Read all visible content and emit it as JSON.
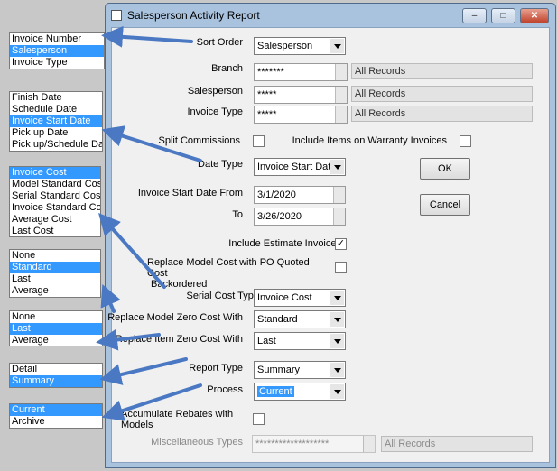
{
  "lists": [
    {
      "items": [
        "Invoice Number",
        "Salesperson",
        "Invoice Type"
      ],
      "selected": 1
    },
    {
      "items": [
        "Finish Date",
        "Schedule Date",
        "Invoice Start Date",
        "Pick up Date",
        "Pick up/Schedule Date"
      ],
      "selected": 2
    },
    {
      "items": [
        "Invoice Cost",
        "Model Standard Cost",
        "Serial Standard Cost",
        "Invoice Standard Cost",
        "Average Cost",
        "Last Cost"
      ],
      "selected": 0
    },
    {
      "items": [
        "None",
        "Standard",
        "Last",
        "Average"
      ],
      "selected": 1
    },
    {
      "items": [
        "None",
        "Last",
        "Average"
      ],
      "selected": 1
    },
    {
      "items": [
        "Detail",
        "Summary"
      ],
      "selected": 1
    },
    {
      "items": [
        "Current",
        "Archive"
      ],
      "selected": 0
    }
  ],
  "window": {
    "title": "Salesperson Activity Report",
    "minimize": "‒",
    "maximize": "□",
    "close": "✕"
  },
  "form": {
    "sort_order": {
      "label": "Sort Order",
      "value": "Salesperson"
    },
    "branch": {
      "label": "Branch",
      "value": "*******",
      "scope": "All Records"
    },
    "salesperson": {
      "label": "Salesperson",
      "value": "*****",
      "scope": "All Records"
    },
    "invoice_type": {
      "label": "Invoice Type",
      "value": "*****",
      "scope": "All Records"
    },
    "split_commissions": {
      "label": "Split Commissions",
      "checked": false
    },
    "include_warranty": {
      "label": "Include Items on Warranty Invoices",
      "checked": false
    },
    "date_type": {
      "label": "Date Type",
      "value": "Invoice Start Dat"
    },
    "start_from": {
      "label": "Invoice Start Date From",
      "value": "3/1/2020"
    },
    "to": {
      "label": "To",
      "value": "3/26/2020"
    },
    "include_estimate": {
      "label": "Include Estimate Invoices",
      "checked": true,
      "mark": "✓"
    },
    "replace_model_cost": {
      "label_line1": "Replace Model Cost with PO Quoted Cost",
      "label_line2": "Backordered",
      "checked": false
    },
    "serial_cost_type": {
      "label": "Serial Cost Type",
      "value": "Invoice Cost"
    },
    "model_zero_cost": {
      "label": "Replace Model Zero Cost With",
      "value": "Standard"
    },
    "item_zero_cost": {
      "label": "Replace Item Zero Cost With",
      "value": "Last"
    },
    "report_type": {
      "label": "Report Type",
      "value": "Summary"
    },
    "process": {
      "label": "Process",
      "value": "Current"
    },
    "accumulate_rebates": {
      "label_line1": "Accumulate Rebates with",
      "label_line2": "Models",
      "checked": false
    },
    "misc_types": {
      "label": "Miscellaneous Types",
      "value": "*******************",
      "scope": "All Records"
    }
  },
  "buttons": {
    "ok": "OK",
    "cancel": "Cancel"
  },
  "colors": {
    "arrow": "#4a78c2",
    "selection": "#3399ff"
  }
}
